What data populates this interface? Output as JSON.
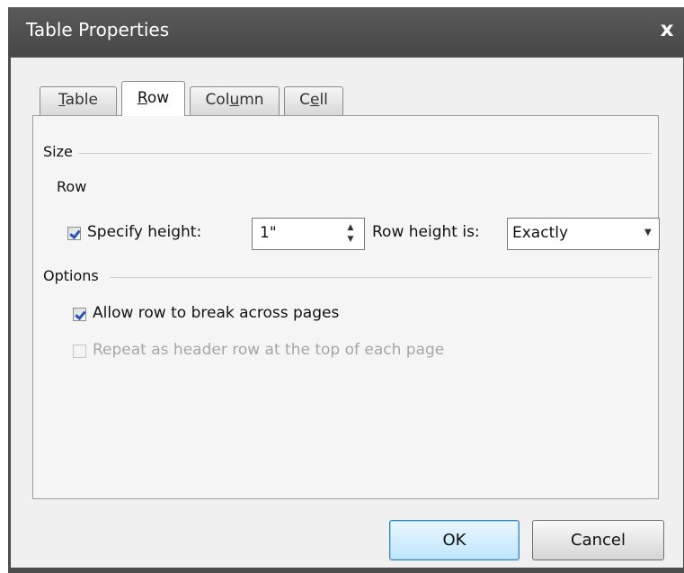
{
  "window": {
    "title": "Table Properties",
    "close_glyph": "x"
  },
  "tabs": [
    {
      "label": "Table",
      "mnemonic": "T",
      "rest": "able",
      "active": false
    },
    {
      "label": "Row",
      "mnemonic": "R",
      "rest": "ow",
      "active": true
    },
    {
      "label": "Column",
      "pre": "Col",
      "mnemonic": "u",
      "rest": "mn",
      "active": false
    },
    {
      "label": "Cell",
      "pre": "C",
      "mnemonic": "e",
      "rest": "ll",
      "active": false
    }
  ],
  "size_section": {
    "label": "Size",
    "row_label": "Row",
    "specify_height": {
      "label": "Specify height:",
      "checked": true
    },
    "height_value": "1\"",
    "row_height_is_label": "Row height is:",
    "row_height_mode": "Exactly"
  },
  "options_section": {
    "label": "Options",
    "allow_break": {
      "label": "Allow row to break across pages",
      "checked": true
    },
    "repeat_header": {
      "label": "Repeat as header row at the top of each page",
      "checked": false,
      "enabled": false
    }
  },
  "buttons": {
    "ok": "OK",
    "cancel": "Cancel"
  },
  "colors": {
    "titlebar": "#4d4d4d",
    "dialog_bg": "#f0f0f0",
    "checkmark": "#2a52be",
    "ok_default_border": "#3c7fb1"
  },
  "icons": {
    "close": "close-icon",
    "spin_up": "spin-up-icon",
    "spin_down": "spin-down-icon",
    "dropdown": "chevron-down-icon"
  }
}
